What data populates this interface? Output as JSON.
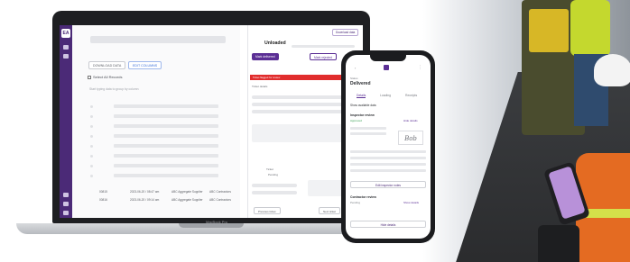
{
  "laptop": {
    "brand_label": "MacBook Pro",
    "rail_logo": "EA",
    "list": {
      "chip_left": "DOWNLOAD DATA",
      "chip_right": "EDIT COLUMNS",
      "select_all": "Select All Records",
      "search_hint": "Start typing data to group by column",
      "rows": [
        {
          "id": "00815",
          "date": "2023-06-20 / 08:47 am",
          "supplier": "ABC Aggregate Supplier",
          "material": "ABC Contractors"
        },
        {
          "id": "00816",
          "date": "2023-06-20 / 09:14 am",
          "supplier": "ABC Aggregate Supplier",
          "material": "ABC Contractors"
        }
      ]
    },
    "detail": {
      "download_button": "Download data",
      "title": "Unloaded",
      "primary_button": "Mark delivered",
      "secondary_button": "Mark rejected",
      "alert_text": "Ticket flagged for review",
      "label_a": "Ticket details",
      "label_b": "Ticket",
      "status_pending": "Pending",
      "footer_left": "Previous ticket",
      "footer_right": "Next ticket"
    }
  },
  "phone": {
    "header_small": "Status",
    "header_title": "Delivered",
    "tabs": [
      "Details",
      "Loading",
      "Receipts"
    ],
    "section_label": "Show available data",
    "inspector_label": "Inspector review",
    "inspector_status": "Approved",
    "inspector_link": "Hide details",
    "signature_text": "Bob",
    "edit_button": "Edit inspector notes",
    "contractor_label": "Contractor review",
    "contractor_status": "Pending",
    "contractor_link": "Show details",
    "bottom_button": "Hide details"
  },
  "colors": {
    "brand_purple": "#5b2f95",
    "rail_purple": "#4b2a77",
    "alert_red": "#e12d2d",
    "success_green": "#2e9c4a"
  }
}
